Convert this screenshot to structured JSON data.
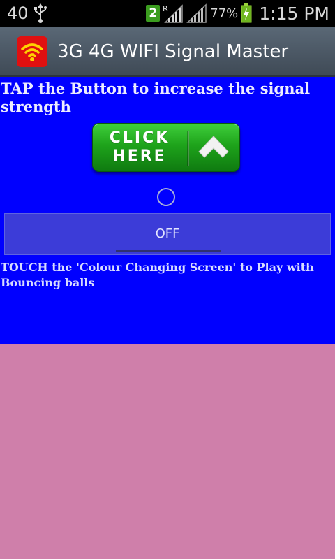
{
  "status_bar": {
    "notification_count": "40",
    "sim_label": "2",
    "roaming_label": "R",
    "battery": "77%",
    "time": "1:15 PM"
  },
  "action_bar": {
    "title": "3G 4G WIFI Signal Master",
    "icon_color": "#e01010",
    "icon": "wifi-icon"
  },
  "content": {
    "background": "#0000ff",
    "instruction": "TAP the Button to increase the signal strength",
    "click_button_text": "CLICK\nHERE",
    "toggle_label": "OFF",
    "touch_note": "TOUCH the 'Colour Changing Screen' to Play with Bouncing balls"
  },
  "play_area": {
    "background": "#cf7faa"
  }
}
